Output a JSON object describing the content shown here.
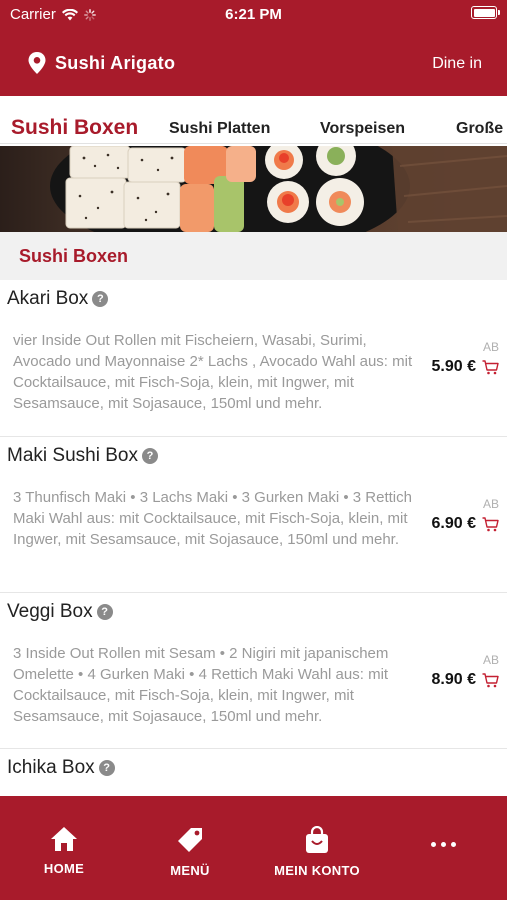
{
  "status_bar": {
    "carrier": "Carrier",
    "time": "6:21 PM"
  },
  "header": {
    "shop_name": "Sushi Arigato",
    "mode": "Dine in"
  },
  "tabs": [
    {
      "label": "Sushi Boxen"
    },
    {
      "label": "Sushi Platten"
    },
    {
      "label": "Vorspeisen"
    },
    {
      "label": "Große"
    }
  ],
  "section": {
    "title": "Sushi Boxen"
  },
  "items": [
    {
      "name": "Akari Box",
      "description": "vier Inside Out Rollen mit Fischeiern, Wasabi, Surimi, Avocado und Mayonnaise 2* Lachs , Avocado Wahl aus: mit Cocktailsauce, mit Fisch-Soja, klein, mit Ingwer, mit Sesamsauce, mit Sojasauce, 150ml und mehr.",
      "price_prefix": "AB",
      "price": "5.90 €"
    },
    {
      "name": "Maki Sushi Box",
      "description": "3 Thunfisch Maki • 3 Lachs Maki • 3 Gurken Maki • 3 Rettich Maki Wahl aus: mit Cocktailsauce, mit Fisch-Soja, klein, mit Ingwer, mit Sesamsauce, mit Sojasauce, 150ml und mehr.",
      "price_prefix": "AB",
      "price": "6.90 €"
    },
    {
      "name": "Veggi Box",
      "description": "3 Inside Out Rollen mit Sesam • 2 Nigiri mit japanischem Omelette • 4 Gurken Maki • 4 Rettich Maki Wahl aus: mit Cocktailsauce, mit Fisch-Soja, klein, mit Ingwer, mit Sesamsauce, mit Sojasauce, 150ml und mehr.",
      "price_prefix": "AB",
      "price": "8.90 €"
    },
    {
      "name": "Ichika Box",
      "description": "",
      "price_prefix": "",
      "price": ""
    }
  ],
  "bottom_nav": [
    {
      "label": "HOME",
      "icon": "home-icon"
    },
    {
      "label": "MENÜ",
      "icon": "tag-icon"
    },
    {
      "label": "MEIN KONTO",
      "icon": "shopping-bag-icon"
    },
    {
      "label": "",
      "icon": "more-icon"
    }
  ],
  "colors": {
    "brand": "#a81b2b",
    "section_bg": "#f1f1f1",
    "description": "#9a9a9a"
  }
}
